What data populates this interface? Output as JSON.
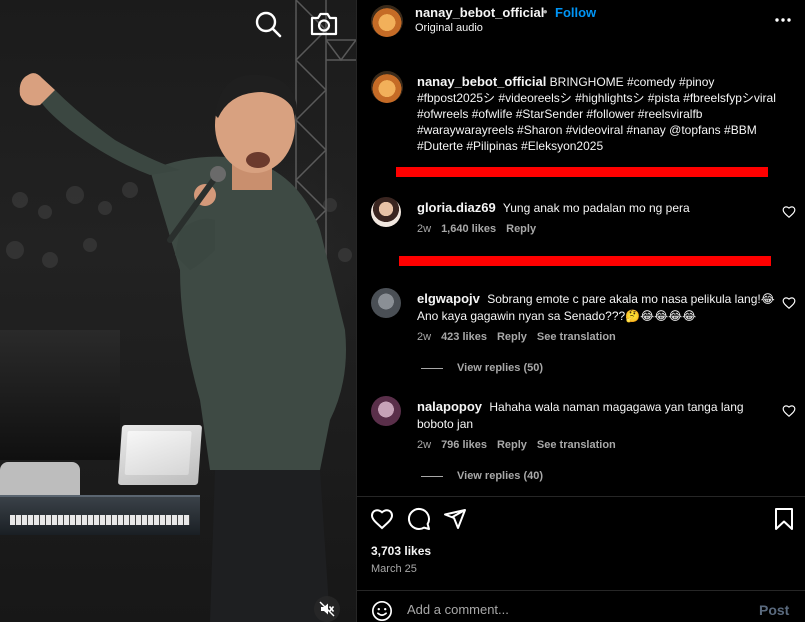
{
  "post": {
    "username": "nanay_bebot_official",
    "dot": "•",
    "follow_label": "Follow",
    "audio_label": "Original audio"
  },
  "caption": {
    "username": "nanay_bebot_official",
    "text": "BRINGHOME #comedy #pinoy #fbpost2025シ #videoreelsシ #highlightsシ #pista #fbreelsfypシviral #ofwreels #ofwlife #StarSender #follower #reelsviralfb #waraywarayreels #Sharon #videoviral #nanay @topfans #BBM #Duterte #Pilipinas #Eleksyon2025"
  },
  "comments": [
    {
      "username": "gloria.diaz69",
      "text": "Yung anak mo padalan mo ng pera",
      "time": "2w",
      "likes": "1,640 likes",
      "reply_label": "Reply",
      "translation_label": "",
      "view_replies": ""
    },
    {
      "username": "elgwapojv",
      "text": "Sobrang emote c pare akala mo nasa pelikula lang!😂 Ano kaya gagawin nyan sa Senado???🤔😂😂😂😂",
      "time": "2w",
      "likes": "423 likes",
      "reply_label": "Reply",
      "translation_label": "See translation",
      "view_replies": "View replies (50)"
    },
    {
      "username": "nalapopoy",
      "text": "Hahaha wala naman magagawa yan tanga lang boboto jan",
      "time": "2w",
      "likes": "796 likes",
      "reply_label": "Reply",
      "translation_label": "See translation",
      "view_replies": "View replies (40)"
    }
  ],
  "stats": {
    "likes": "3,703 likes",
    "date": "March 25"
  },
  "composer": {
    "placeholder": "Add a comment...",
    "post_label": "Post"
  },
  "icons": {
    "video": [
      "search-icon",
      "camera-icon",
      "muted-speaker-icon"
    ],
    "actions": [
      "heart-icon",
      "comment-icon",
      "share-icon",
      "bookmark-icon"
    ],
    "header": [
      "more-options-icon"
    ],
    "composer": [
      "emoji-icon"
    ]
  },
  "colors": {
    "accent": "#0095f6",
    "redaction": "#ff0000",
    "background": "#000000",
    "muted_text": "#a8a8a8"
  }
}
